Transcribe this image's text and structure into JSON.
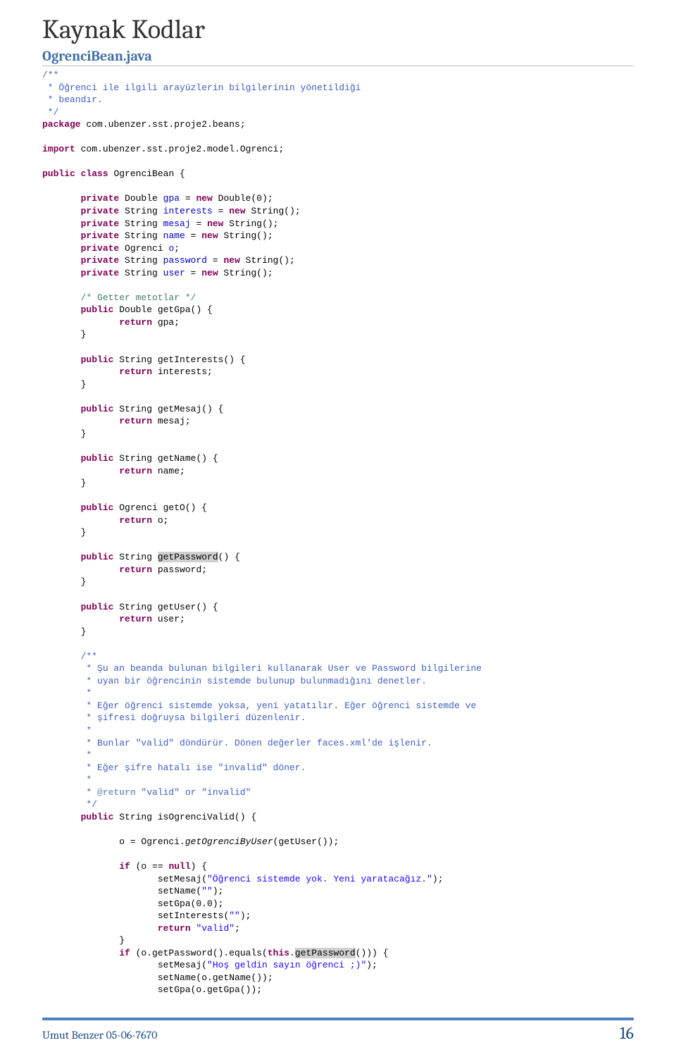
{
  "heading": "Kaynak Kodlar",
  "subheading": "OgrenciBean.java",
  "code": {
    "c0": "/**",
    "c1": " * Öğrenci ile ilgili arayüzlerin bilgilerinin yönetildiği",
    "c2": " * beandır.",
    "c3": " */",
    "k_package": "package",
    "pkg_name": " com.ubenzer.sst.proje2.beans;",
    "k_import": "import",
    "imp_name": " com.ubenzer.sst.proje2.model.Ogrenci;",
    "k_public": "public",
    "k_class": "class",
    "class_name": " OgrenciBean {",
    "k_private": "private",
    "k_new": "new",
    "k_return": "return",
    "k_if": "if",
    "k_null": "null",
    "k_this": "this",
    "t_Double": " Double ",
    "t_String": " String ",
    "t_Ogrenci": " Ogrenci ",
    "f_gpa": "gpa",
    "f_interests": "interests",
    "f_mesaj": "mesaj",
    "f_name": "name",
    "f_o": "o",
    "f_password": "password",
    "f_user": "user",
    "eq_newDouble0": " = ",
    "newDouble0": " Double(0);",
    "eq_newString": " = ",
    "newString": " String();",
    "o_decl_tail": ";",
    "cm_getter": "/* Getter metotlar */",
    "m_getGpa_sig": " Double getGpa() {",
    "m_getInterests_sig": " String getInterests() {",
    "m_getMesaj_sig": " String getMesaj() {",
    "m_getName_sig": " String getName() {",
    "m_getO_sig": " Ogrenci getO() {",
    "m_getPassword_pre": " String ",
    "m_getPassword_hl": "getPassword",
    "m_getPassword_post": "() {",
    "m_getUser_sig": " String getUser() {",
    "ret_gpa": " gpa;",
    "ret_interests": " interests;",
    "ret_mesaj": " mesaj;",
    "ret_name": " name;",
    "ret_o": " o;",
    "ret_password": " password;",
    "ret_user": " user;",
    "brace_close": "}",
    "jd0": "/**",
    "jd1": " * Şu an beanda bulunan bilgileri kullanarak User ve Password bilgilerine",
    "jd2": " * uyan bir öğrencinin sistemde bulunup bulunmadığını denetler.",
    "jd3": " *",
    "jd4": " * Eğer öğrenci sistemde yoksa, yeni yatatılır. Eğer öğrenci sistemde ve",
    "jd5": " * şifresi doğruysa bilgileri düzenlenir.",
    "jd6": " *",
    "jd7": " * Bunlar \"valid\" döndürür. Dönen değerler faces.xml'de işlenir.",
    "jd8": " *",
    "jd9": " * Eğer şifre hatalı ise \"invalid\" döner.",
    "jd10": " *",
    "jd11_pre": " * ",
    "jd11_tag": "@return",
    "jd11_post": " \"valid\" or \"invalid\"",
    "jd12": " */",
    "m_isOgrenciValid_sig": " String isOgrenciValid() {",
    "body_o_assign_pre": "o = Ogrenci.",
    "body_o_assign_mid": "getOgrenciByUser",
    "body_o_assign_post": "(getUser());",
    "if_cond_pre": " (o == ",
    "if_cond_post": ") {",
    "setMesaj_pre": "setMesaj(",
    "str_noStudent": "\"Öğrenci sistemde yok. Yeni yaratacağız.\"",
    "close_paren_semi": ");",
    "setName_empty_pre": "setName(",
    "str_empty": "\"\"",
    "setGpa0": "setGpa(0.0);",
    "setInterests_empty_pre": "setInterests(",
    "ret_valid_pre": " ",
    "str_valid": "\"valid\"",
    "semi": ";",
    "if_password_pre": " (o.getPassword().equals(",
    "if_password_this": ".",
    "if_password_hl": "getPassword",
    "if_password_post": "())) {",
    "str_welcome": "\"Hoş geldin sayın öğrenci ;)\"",
    "setName_o": "setName(o.getName());",
    "setGpa_o": "setGpa(o.getGpa());"
  },
  "footer": {
    "left": "Umut Benzer 05-06-7670",
    "right": "16"
  }
}
